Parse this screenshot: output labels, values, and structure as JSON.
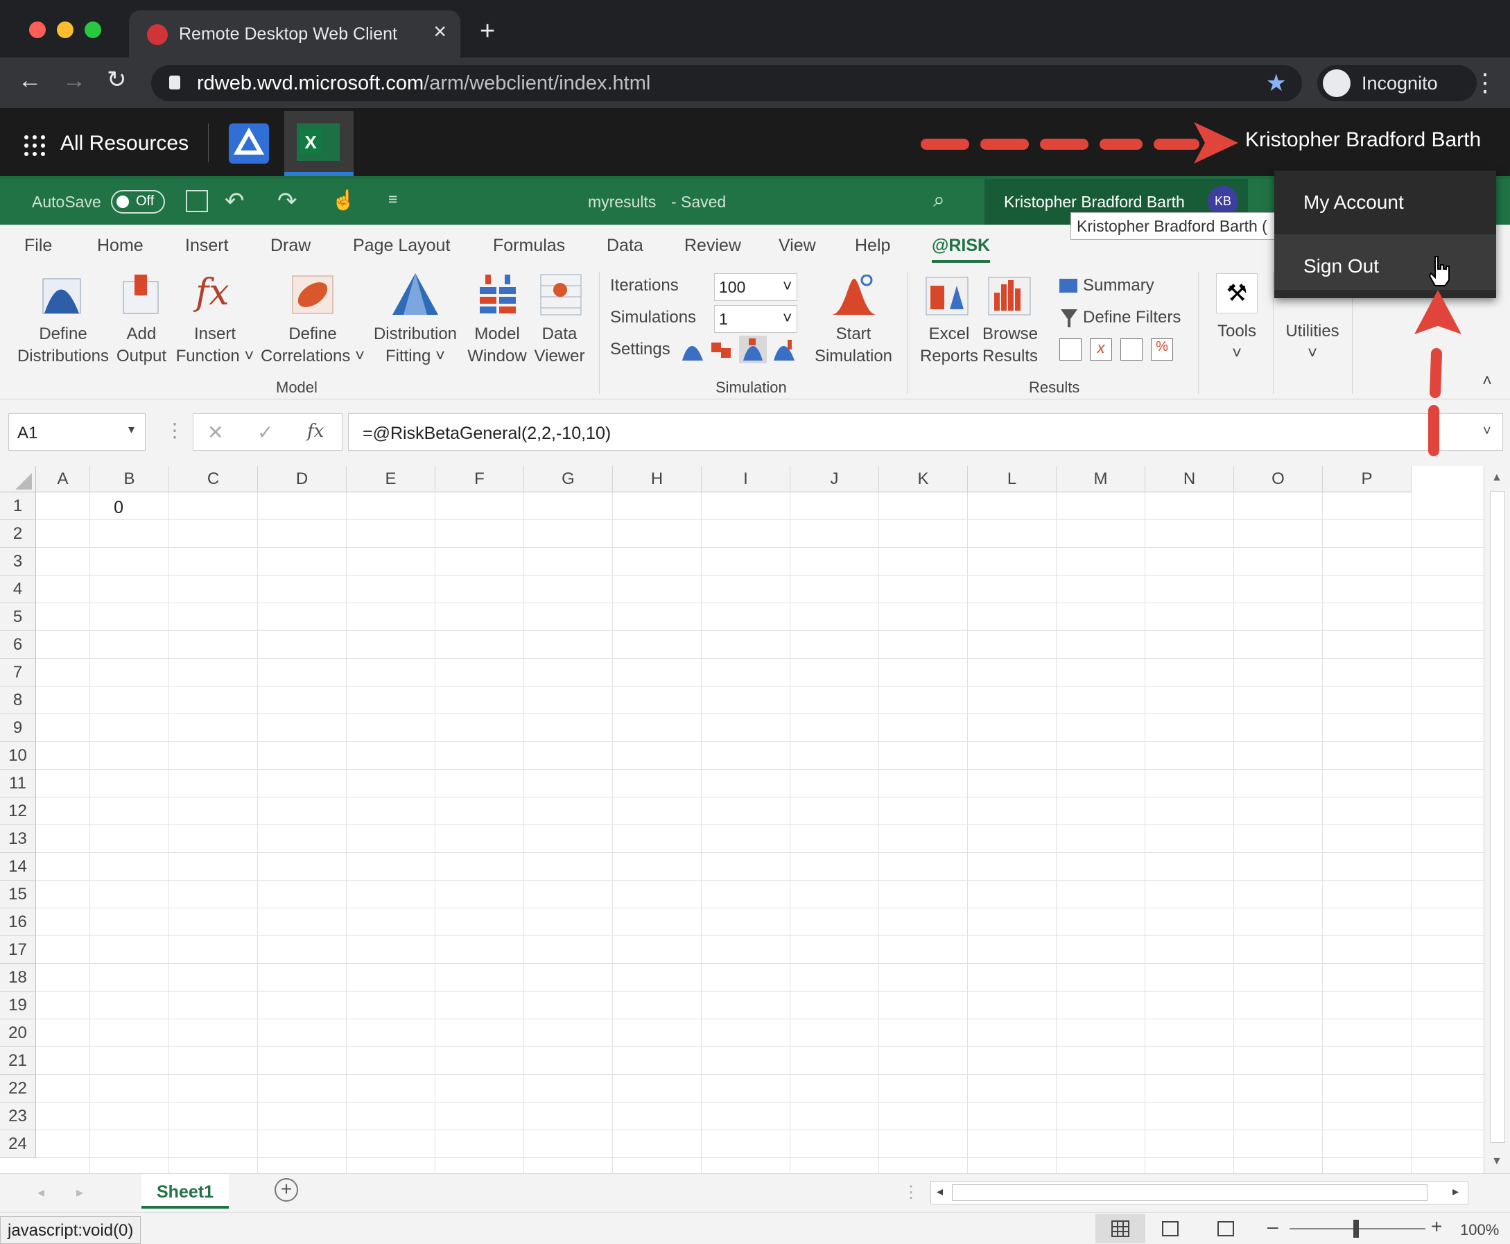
{
  "browser": {
    "tab_title": "Remote Desktop Web Client",
    "url_host": "rdweb.wvd.microsoft.com",
    "url_path": "/arm/webclient/index.html",
    "incognito_label": "Incognito"
  },
  "rd": {
    "all_resources": "All Resources",
    "user": "Kristopher Bradford Barth"
  },
  "excel": {
    "autosave": "AutoSave",
    "autosave_state": "Off",
    "doc_title": "myresults",
    "doc_status": "Saved",
    "user_name": "Kristopher Bradford Barth",
    "user_initials": "KB",
    "tooltip": "Kristopher Bradford Barth (",
    "tabs": [
      "File",
      "Home",
      "Insert",
      "Draw",
      "Page Layout",
      "Formulas",
      "Data",
      "Review",
      "View",
      "Help",
      "@RISK"
    ],
    "ribbon": {
      "model": {
        "define_distributions": [
          "Define",
          "Distributions"
        ],
        "add_output": [
          "Add",
          "Output"
        ],
        "insert_function": [
          "Insert",
          "Function"
        ],
        "define_correlations": [
          "Define",
          "Correlations"
        ],
        "distribution_fitting": [
          "Distribution",
          "Fitting"
        ],
        "model_window": [
          "Model",
          "Window"
        ],
        "data_viewer": [
          "Data",
          "Viewer"
        ],
        "group": "Model"
      },
      "simulation": {
        "iterations_label": "Iterations",
        "iterations_value": "100",
        "simulations_label": "Simulations",
        "simulations_value": "1",
        "settings_label": "Settings",
        "start": [
          "Start",
          "Simulation"
        ],
        "group": "Simulation"
      },
      "results": {
        "excel_reports": [
          "Excel",
          "Reports"
        ],
        "browse_results": [
          "Browse",
          "Results"
        ],
        "summary": "Summary",
        "define_filters": "Define Filters",
        "group": "Results"
      },
      "tools": "Tools",
      "utilities": "Utilities"
    },
    "name_box": "A1",
    "formula": "=@RiskBetaGeneral(2,2,-10,10)",
    "columns": [
      "A",
      "B",
      "C",
      "D",
      "E",
      "F",
      "G",
      "H",
      "I",
      "J",
      "K",
      "L",
      "M",
      "N",
      "O",
      "P"
    ],
    "rows": [
      "1",
      "2",
      "3",
      "4",
      "5",
      "6",
      "7",
      "8",
      "9",
      "10",
      "11",
      "12",
      "13",
      "14",
      "15",
      "16",
      "17",
      "18",
      "19",
      "20",
      "21",
      "22",
      "23",
      "24"
    ],
    "cell_a1": "0",
    "sheet_tab": "Sheet1",
    "zoom": "100%"
  },
  "menu": {
    "my_account": "My Account",
    "sign_out": "Sign Out"
  },
  "status_link": "javascript:void(0)",
  "colors": {
    "excel_green": "#217346",
    "annotation_red": "#e0443a",
    "chrome_dark": "#202124"
  }
}
